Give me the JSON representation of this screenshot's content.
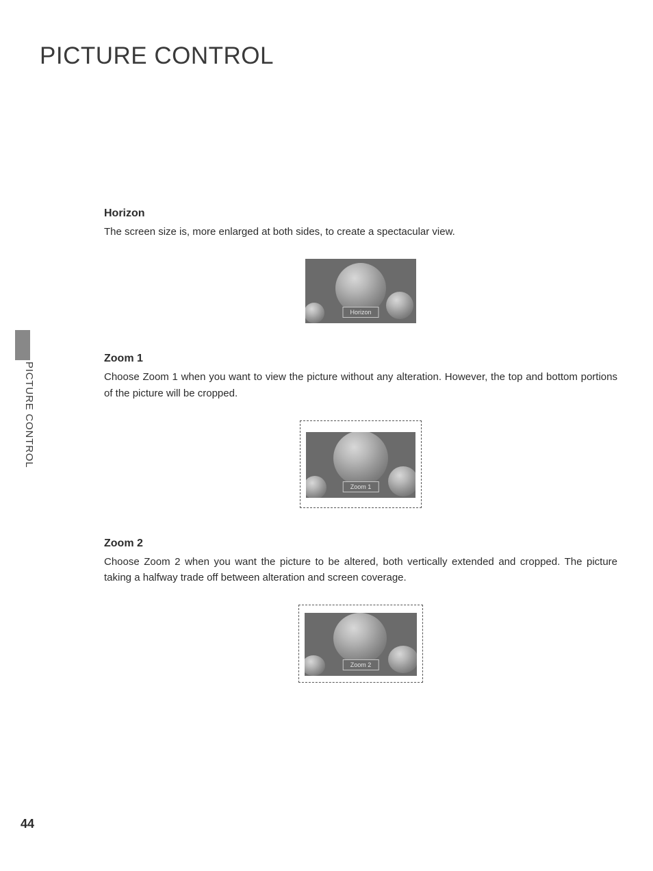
{
  "page": {
    "title": "PICTURE CONTROL",
    "side_label": "PICTURE CONTROL",
    "number": "44"
  },
  "sections": {
    "horizon": {
      "heading": "Horizon",
      "desc": "The screen size is, more enlarged at both sides, to create a spectacular view.",
      "label": "Horizon"
    },
    "zoom1": {
      "heading": "Zoom 1",
      "desc": "Choose Zoom 1 when you want to view the picture without any alteration. However, the top and bottom portions of the picture will be cropped.",
      "label": "Zoom 1"
    },
    "zoom2": {
      "heading": "Zoom 2",
      "desc": "Choose Zoom 2 when you want the picture to be altered, both vertically extended and cropped. The picture taking a halfway trade off between alteration and screen coverage.",
      "label": "Zoom 2"
    }
  }
}
